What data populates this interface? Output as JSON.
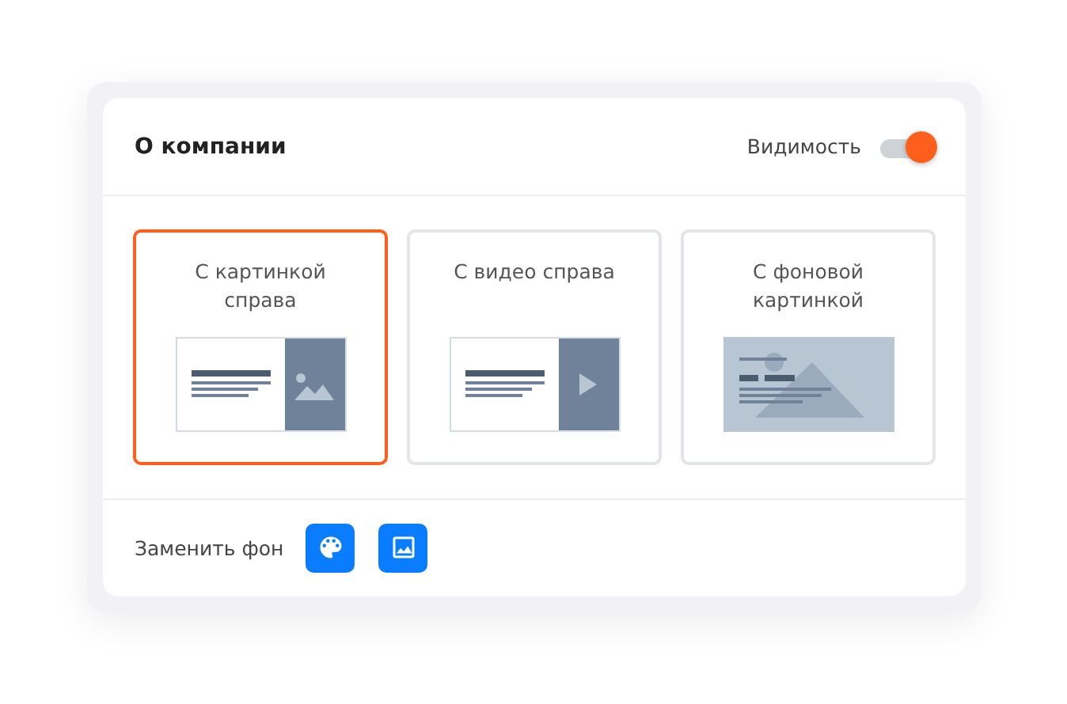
{
  "header": {
    "title": "О компании",
    "visibility_label": "Видимость",
    "visibility_on": true
  },
  "layouts": [
    {
      "label": "С картинкой справа",
      "kind": "image-right",
      "selected": true
    },
    {
      "label": "С видео справа",
      "kind": "video-right",
      "selected": false
    },
    {
      "label": "С фоновой картинкой",
      "kind": "background",
      "selected": false
    }
  ],
  "footer": {
    "label": "Заменить фон"
  }
}
